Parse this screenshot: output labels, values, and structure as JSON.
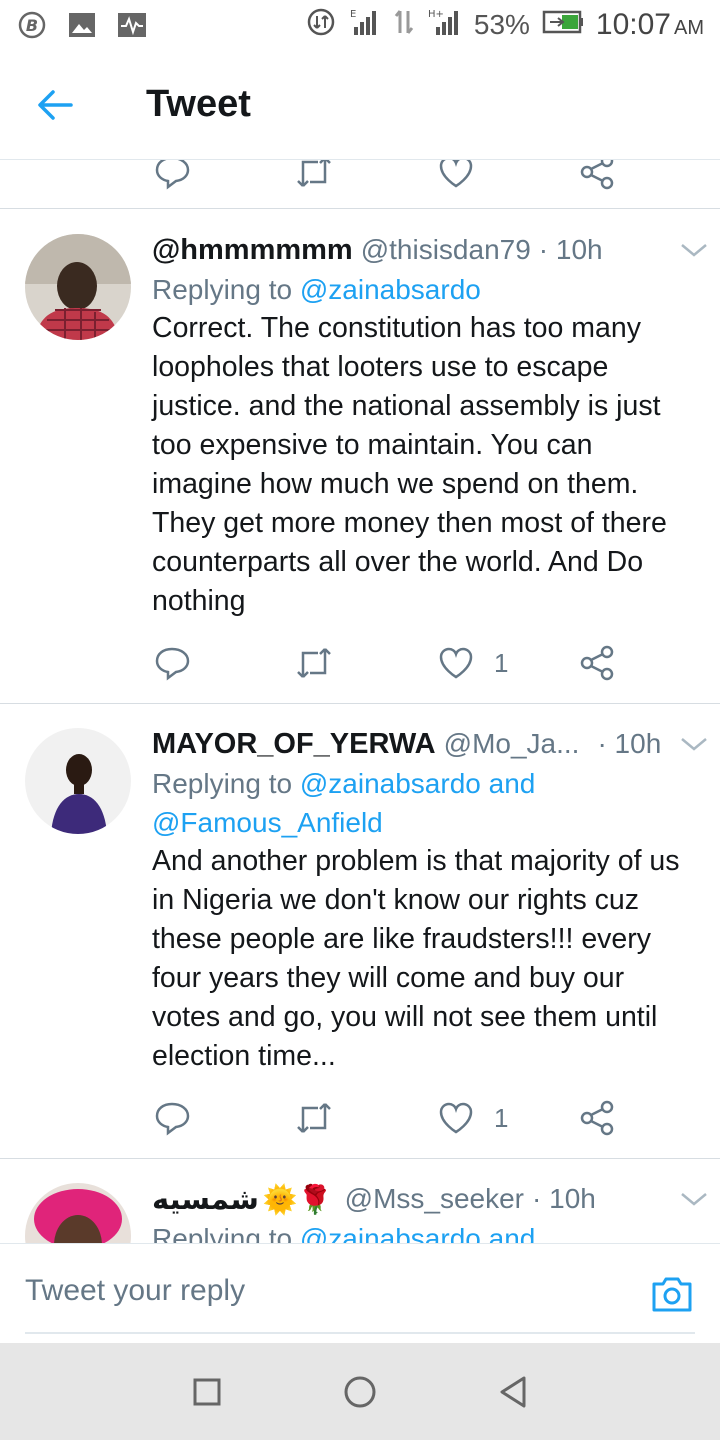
{
  "status_bar": {
    "battery": "53%",
    "time": "10:07",
    "ampm": "AM",
    "icons": [
      "b-circle-icon",
      "image-icon",
      "activity-icon",
      "data-saver-icon",
      "signal-e-icon",
      "data-arrows-icon",
      "signal-h-plus-icon",
      "battery-icon"
    ]
  },
  "header": {
    "title": "Tweet",
    "back_icon": "arrow-left-icon"
  },
  "tweets": [
    {
      "name": "@hmmmmmm",
      "handle": "@thisisdan79",
      "time": "· 10h",
      "replying_prefix": "Replying to ",
      "replying_to": "@zainabsardo",
      "body": "Correct. The constitution has too many loopholes that looters use to escape justice. and the national assembly is just too expensive to maintain. You can imagine how much we spend on them. They get more money then most of there counterparts all over the world. And Do nothing",
      "likes": "1"
    },
    {
      "name": "MAYOR_OF_YERWA",
      "handle": "@Mo_Ja...",
      "time": "· 10h",
      "replying_prefix": "Replying to ",
      "replying_to": "@zainabsardo and @Famous_Anfield",
      "body": "And another problem is that majority of us in Nigeria we don't know our rights cuz these people are like fraudsters!!! every four years they will come and buy our votes and go, you will not see them until election time...",
      "likes": "1"
    },
    {
      "name": "شمسيه",
      "name_emoji": "🌞🌹",
      "handle": "@Mss_seeker",
      "time": "· 10h",
      "replying_prefix": "Replying to ",
      "replying_to": "@zainabsardo and"
    }
  ],
  "reply_bar": {
    "placeholder": "Tweet your reply"
  },
  "colors": {
    "accent": "#1da1f2",
    "muted": "#657786",
    "divider": "#d7dde2"
  }
}
